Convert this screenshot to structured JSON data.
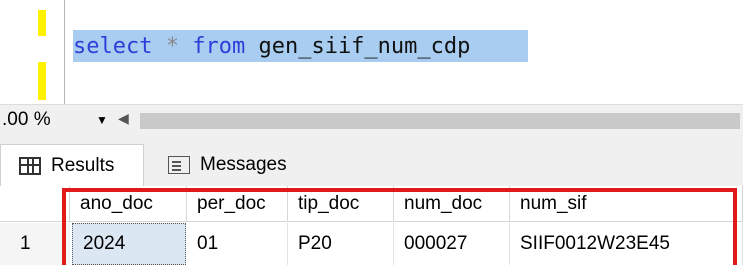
{
  "editor": {
    "keyword_select": "select",
    "operator_star": "*",
    "keyword_from": "from",
    "table_name": "gen_siif_num_cdp"
  },
  "zoom": {
    "value": ".00 %"
  },
  "tabs": [
    {
      "label": "Results",
      "icon": "grid-icon"
    },
    {
      "label": "Messages",
      "icon": "messages-icon"
    }
  ],
  "results": {
    "columns": [
      "ano_doc",
      "per_doc",
      "tip_doc",
      "num_doc",
      "num_sif"
    ],
    "rows": [
      {
        "rownum": "1",
        "cells": [
          "2024",
          "01",
          "P20",
          "000027",
          "SIIF0012W23E45"
        ]
      }
    ]
  },
  "colors": {
    "highlight_box": "#e0191b",
    "keyword": "#2f3dd9",
    "selection": "#a8cdf0"
  }
}
